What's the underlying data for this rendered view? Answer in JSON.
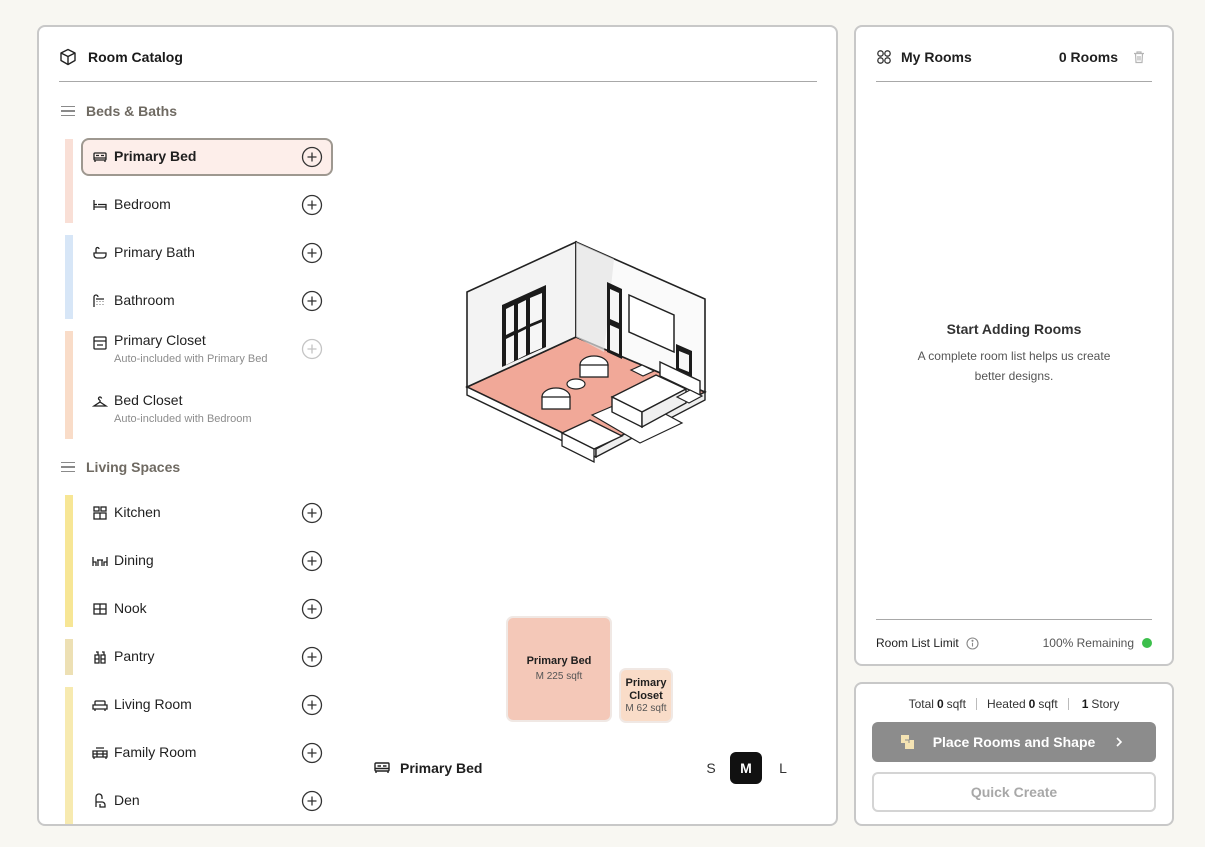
{
  "catalog": {
    "title": "Room Catalog",
    "sections": [
      {
        "label": "Beds & Baths"
      },
      {
        "label": "Living Spaces"
      }
    ],
    "items": [
      {
        "label": "Primary Bed",
        "sub": ""
      },
      {
        "label": "Bedroom",
        "sub": ""
      },
      {
        "label": "Primary Bath",
        "sub": ""
      },
      {
        "label": "Bathroom",
        "sub": ""
      },
      {
        "label": "Primary Closet",
        "sub": "Auto-included with Primary Bed"
      },
      {
        "label": "Bed Closet",
        "sub": "Auto-included with Bedroom"
      },
      {
        "label": "Kitchen",
        "sub": ""
      },
      {
        "label": "Dining",
        "sub": ""
      },
      {
        "label": "Nook",
        "sub": ""
      },
      {
        "label": "Pantry",
        "sub": ""
      },
      {
        "label": "Living Room",
        "sub": ""
      },
      {
        "label": "Family Room",
        "sub": ""
      },
      {
        "label": "Den",
        "sub": ""
      }
    ],
    "colors": {
      "beds": "#f9dfd6",
      "baths": "#d7e6f7",
      "closets": "#f9dcc8",
      "living": "#f7e695",
      "pantry": "#ede0b4",
      "living2": "#f7eab0",
      "selected_bg": "#fdeeea"
    }
  },
  "preview": {
    "tile_main_name": "Primary Bed",
    "tile_main_size": "M 225 sqft",
    "tile_closet_name": "Primary Closet",
    "tile_closet_size": "M 62 sqft",
    "selected_room": "Primary Bed",
    "sizes": [
      "S",
      "M",
      "L"
    ],
    "active_size": "M"
  },
  "my_rooms": {
    "title": "My Rooms",
    "count": "0 Rooms",
    "empty_title": "Start Adding Rooms",
    "empty_desc": "A complete room list helps us create better designs.",
    "limit_label": "Room List Limit",
    "limit_remaining": "100% Remaining"
  },
  "totals": {
    "total_label": "Total",
    "total_value": "0",
    "total_unit": "sqft",
    "heated_label": "Heated",
    "heated_value": "0",
    "heated_unit": "sqft",
    "story_value": "1",
    "story_label": "Story"
  },
  "buttons": {
    "place": "Place Rooms and Shape",
    "quick": "Quick Create"
  }
}
